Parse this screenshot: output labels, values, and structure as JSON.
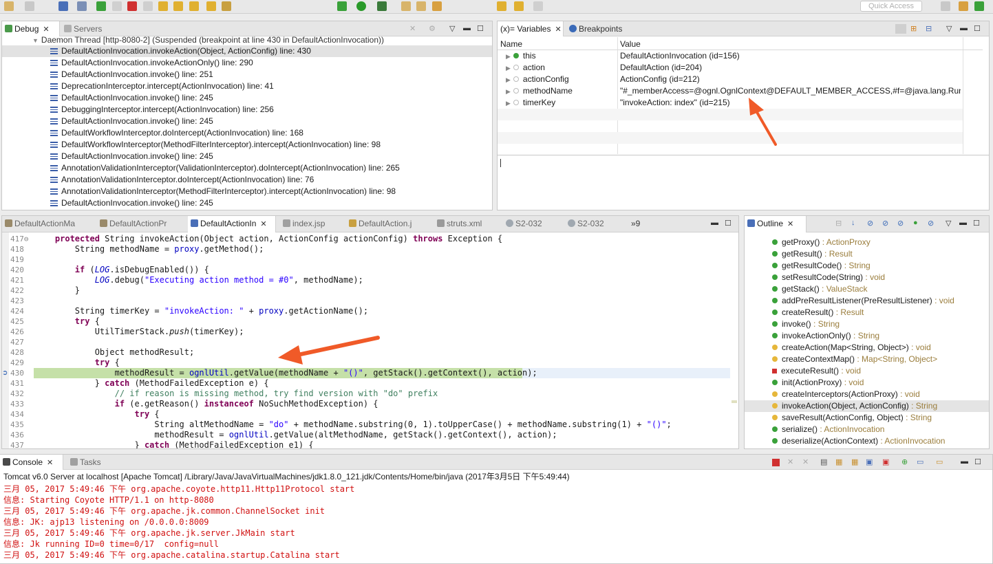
{
  "toolbar": {
    "quick_access": "Quick Access"
  },
  "debug": {
    "tabs": [
      {
        "label": "Debug"
      },
      {
        "label": "Servers"
      }
    ],
    "thread": "Daemon Thread [http-8080-2] (Suspended (breakpoint at line 430 in DefaultActionInvocation))",
    "frames": [
      "DefaultActionInvocation.invokeAction(Object, ActionConfig) line: 430",
      "DefaultActionInvocation.invokeActionOnly() line: 290",
      "DefaultActionInvocation.invoke() line: 251",
      "DeprecationInterceptor.intercept(ActionInvocation) line: 41",
      "DefaultActionInvocation.invoke() line: 245",
      "DebuggingInterceptor.intercept(ActionInvocation) line: 256",
      "DefaultActionInvocation.invoke() line: 245",
      "DefaultWorkflowInterceptor.doIntercept(ActionInvocation) line: 168",
      "DefaultWorkflowInterceptor(MethodFilterInterceptor).intercept(ActionInvocation) line: 98",
      "DefaultActionInvocation.invoke() line: 245",
      "AnnotationValidationInterceptor(ValidationInterceptor).doIntercept(ActionInvocation) line: 265",
      "AnnotationValidationInterceptor.doIntercept(ActionInvocation) line: 76",
      "AnnotationValidationInterceptor(MethodFilterInterceptor).intercept(ActionInvocation) line: 98",
      "DefaultActionInvocation.invoke() line: 245"
    ]
  },
  "variables": {
    "tabs": [
      {
        "label": "(x)= Variables"
      },
      {
        "label": "Breakpoints"
      }
    ],
    "col_name": "Name",
    "col_value": "Value",
    "rows": [
      {
        "name": "this",
        "value": "DefaultActionInvocation  (id=156)"
      },
      {
        "name": "action",
        "value": "DefaultAction  (id=204)"
      },
      {
        "name": "actionConfig",
        "value": "ActionConfig  (id=212)"
      },
      {
        "name": "methodName",
        "value": "\"#_memberAccess=@ognl.OgnlContext@DEFAULT_MEMBER_ACCESS,#f=@java.lang.Runtim..."
      },
      {
        "name": "timerKey",
        "value": "\"invokeAction: index\" (id=215)"
      }
    ]
  },
  "editor": {
    "tabs": [
      {
        "label": "DefaultActionMa"
      },
      {
        "label": "DefaultActionPr"
      },
      {
        "label": "DefaultActionIn"
      },
      {
        "label": "index.jsp"
      },
      {
        "label": "DefaultAction.j"
      },
      {
        "label": "struts.xml"
      },
      {
        "label": "S2-032"
      },
      {
        "label": "S2-032"
      },
      {
        "label": "»9"
      }
    ],
    "lines": [
      {
        "n": "417⊖",
        "code": "    protected String invokeAction(Object action, ActionConfig actionConfig) throws Exception {"
      },
      {
        "n": "418",
        "code": "        String methodName = proxy.getMethod();"
      },
      {
        "n": "419",
        "code": ""
      },
      {
        "n": "420",
        "code": "        if (LOG.isDebugEnabled()) {"
      },
      {
        "n": "421",
        "code": "            LOG.debug(\"Executing action method = #0\", methodName);"
      },
      {
        "n": "422",
        "code": "        }"
      },
      {
        "n": "423",
        "code": ""
      },
      {
        "n": "424",
        "code": "        String timerKey = \"invokeAction: \" + proxy.getActionName();"
      },
      {
        "n": "425",
        "code": "        try {"
      },
      {
        "n": "426",
        "code": "            UtilTimerStack.push(timerKey);"
      },
      {
        "n": "427",
        "code": ""
      },
      {
        "n": "428",
        "code": "            Object methodResult;"
      },
      {
        "n": "429",
        "code": "            try {"
      },
      {
        "n": "430",
        "code": "                methodResult = ognlUtil.getValue(methodName + \"()\", getStack().getContext(), action);"
      },
      {
        "n": "431",
        "code": "            } catch (MethodFailedException e) {"
      },
      {
        "n": "432",
        "code": "                // if reason is missing method, try find version with \"do\" prefix"
      },
      {
        "n": "433",
        "code": "                if (e.getReason() instanceof NoSuchMethodException) {"
      },
      {
        "n": "434",
        "code": "                    try {"
      },
      {
        "n": "435",
        "code": "                        String altMethodName = \"do\" + methodName.substring(0, 1).toUpperCase() + methodName.substring(1) + \"()\";"
      },
      {
        "n": "436",
        "code": "                        methodResult = ognlUtil.getValue(altMethodName, getStack().getContext(), action);"
      },
      {
        "n": "437",
        "code": "                    } catch (MethodFailedException e1) {"
      }
    ]
  },
  "outline": {
    "tab": "Outline",
    "items": [
      {
        "name": "getProxy()",
        "type": " : ActionProxy",
        "icon": "green"
      },
      {
        "name": "getResult()",
        "type": " : Result",
        "icon": "green"
      },
      {
        "name": "getResultCode()",
        "type": " : String",
        "icon": "green"
      },
      {
        "name": "setResultCode(String)",
        "type": " : void",
        "icon": "green"
      },
      {
        "name": "getStack()",
        "type": " : ValueStack",
        "icon": "green"
      },
      {
        "name": "addPreResultListener(PreResultListener)",
        "type": " : void",
        "icon": "green"
      },
      {
        "name": "createResult()",
        "type": " : Result",
        "icon": "green"
      },
      {
        "name": "invoke()",
        "type": " : String",
        "icon": "green"
      },
      {
        "name": "invokeActionOnly()",
        "type": " : String",
        "icon": "green"
      },
      {
        "name": "createAction(Map<String, Object>)",
        "type": " : void",
        "icon": "yellow"
      },
      {
        "name": "createContextMap()",
        "type": " : Map<String, Object>",
        "icon": "yellow"
      },
      {
        "name": "executeResult()",
        "type": " : void",
        "icon": "red"
      },
      {
        "name": "init(ActionProxy)",
        "type": " : void",
        "icon": "green"
      },
      {
        "name": "createInterceptors(ActionProxy)",
        "type": " : void",
        "icon": "yellow"
      },
      {
        "name": "invokeAction(Object, ActionConfig)",
        "type": " : String",
        "icon": "yellow"
      },
      {
        "name": "saveResult(ActionConfig, Object)",
        "type": " : String",
        "icon": "yellow"
      },
      {
        "name": "serialize()",
        "type": " : ActionInvocation",
        "icon": "green"
      },
      {
        "name": "deserialize(ActionContext)",
        "type": " : ActionInvocation",
        "icon": "green"
      }
    ]
  },
  "console": {
    "tabs": [
      {
        "label": "Console"
      },
      {
        "label": "Tasks"
      }
    ],
    "title": "Tomcat v6.0 Server at localhost [Apache Tomcat] /Library/Java/JavaVirtualMachines/jdk1.8.0_121.jdk/Contents/Home/bin/java (2017年3月5日 下午5:49:44)",
    "lines": [
      "三月 05, 2017 5:49:46 下午 org.apache.coyote.http11.Http11Protocol start",
      "信息: Starting Coyote HTTP/1.1 on http-8080",
      "三月 05, 2017 5:49:46 下午 org.apache.jk.common.ChannelSocket init",
      "信息: JK: ajp13 listening on /0.0.0.0:8009",
      "三月 05, 2017 5:49:46 下午 org.apache.jk.server.JkMain start",
      "信息: Jk running ID=0 time=0/17  config=null",
      "三月 05, 2017 5:49:46 下午 org.apache.catalina.startup.Catalina start"
    ]
  },
  "colors": {
    "highlight": "#c5e0a8",
    "console_text": "#d01010",
    "arrow": "#f05a28"
  }
}
